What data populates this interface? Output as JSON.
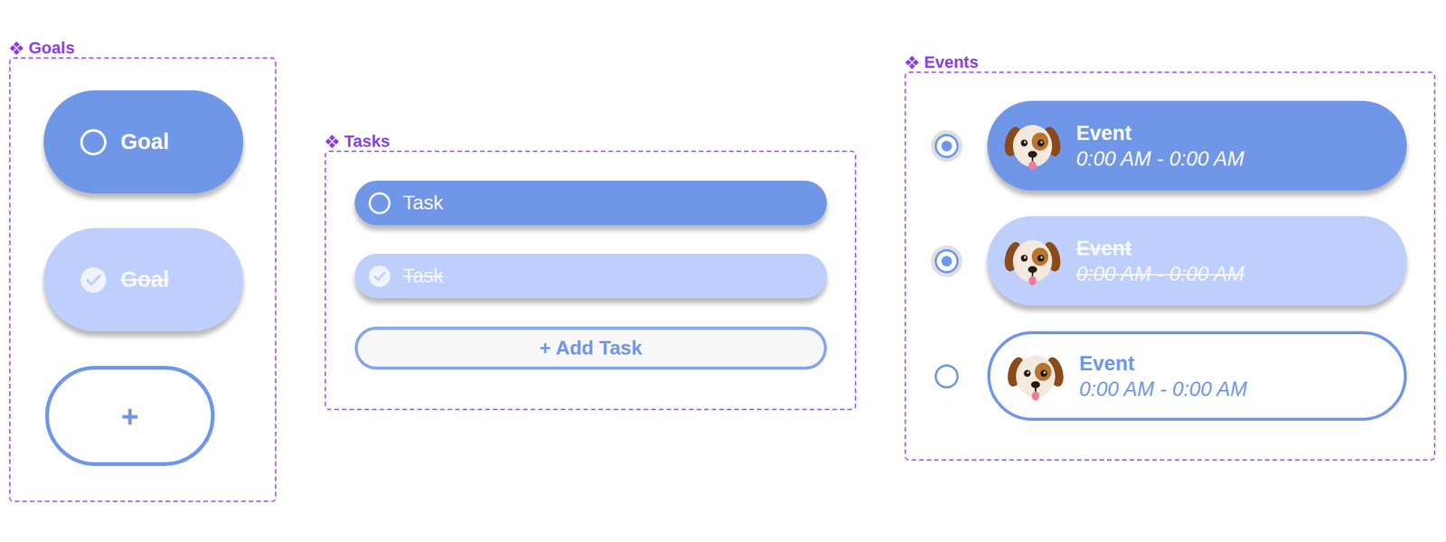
{
  "goals": {
    "label": "Goals",
    "items": [
      {
        "title": "Goal",
        "completed": false
      },
      {
        "title": "Goal",
        "completed": true
      }
    ],
    "add_button": "+"
  },
  "tasks": {
    "label": "Tasks",
    "items": [
      {
        "title": "Task",
        "completed": false
      },
      {
        "title": "Task",
        "completed": true
      }
    ],
    "add_button": "+ Add Task"
  },
  "events": {
    "label": "Events",
    "items": [
      {
        "title": "Event",
        "time": "0:00 AM - 0:00 AM",
        "completed": false,
        "selected": true,
        "kind": "filled"
      },
      {
        "title": "Event",
        "time": "0:00 AM - 0:00 AM",
        "completed": true,
        "selected": true,
        "kind": "filled"
      },
      {
        "title": "Event",
        "time": "0:00 AM - 0:00 AM",
        "completed": false,
        "selected": false,
        "kind": "outline"
      }
    ]
  }
}
